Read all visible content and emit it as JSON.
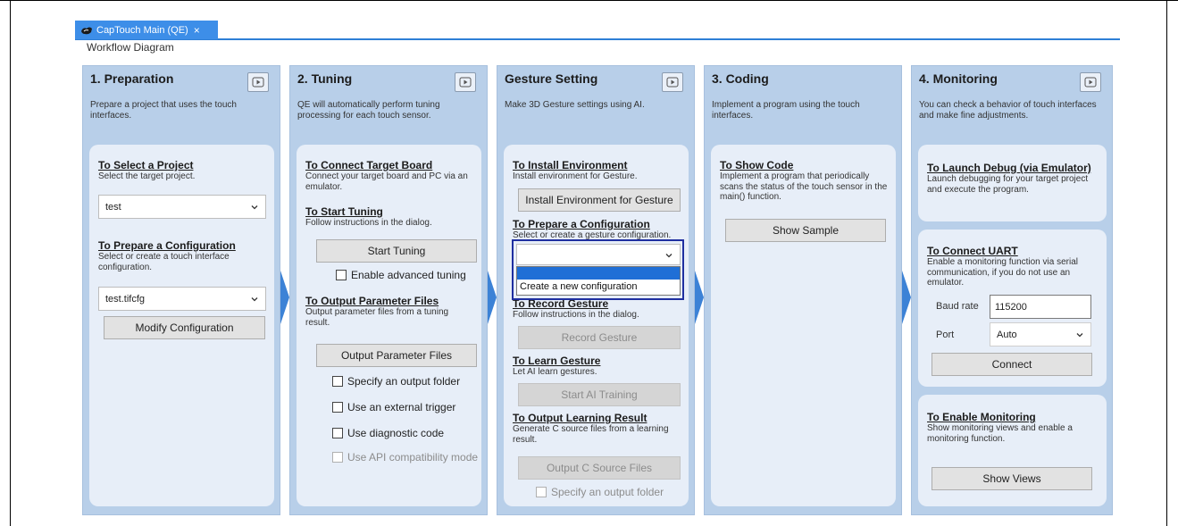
{
  "tab": {
    "title": "CapTouch Main (QE)",
    "close": "×"
  },
  "view_title": "Workflow Diagram",
  "columns": {
    "preparation": {
      "title": "1. Preparation",
      "desc": "Prepare a project that uses the touch interfaces.",
      "select_project": {
        "title": "To Select a Project",
        "desc": "Select the target project.",
        "value": "test"
      },
      "prepare_config": {
        "title": "To Prepare a Configuration",
        "desc": "Select or create a touch interface configuration.",
        "value": "test.tifcfg"
      },
      "modify_button": "Modify Configuration"
    },
    "tuning": {
      "title": "2. Tuning",
      "desc": "QE will automatically perform tuning processing for each touch sensor.",
      "connect": {
        "title": "To Connect Target Board",
        "desc": "Connect your target board and PC via an emulator."
      },
      "start": {
        "title": "To Start Tuning",
        "desc": "Follow instructions in the dialog.",
        "button": "Start Tuning",
        "advanced": "Enable advanced tuning"
      },
      "output": {
        "title": "To Output Parameter Files",
        "desc": "Output parameter files from a tuning result.",
        "button": "Output Parameter Files",
        "opt1": "Specify an output folder",
        "opt2": "Use an external trigger",
        "opt3": "Use diagnostic code",
        "opt4": "Use API compatibility mode"
      }
    },
    "gesture": {
      "title": "Gesture Setting",
      "desc": "Make 3D Gesture settings using AI.",
      "install": {
        "title": "To Install Environment",
        "desc": "Install environment for Gesture.",
        "button": "Install Environment for Gesture"
      },
      "prepare": {
        "title": "To Prepare a Configuration",
        "desc": "Select or create a gesture configuration.",
        "value": "",
        "option_new": "Create a new configuration"
      },
      "record": {
        "title": "To Record Gesture",
        "desc": "Follow instructions in the dialog.",
        "button": "Record Gesture"
      },
      "learn": {
        "title": "To Learn Gesture",
        "desc": "Let AI learn gestures.",
        "button": "Start AI Training"
      },
      "output": {
        "title": "To Output Learning Result",
        "desc": "Generate C source files from a learning result.",
        "button": "Output C Source Files",
        "opt": "Specify an output folder"
      }
    },
    "coding": {
      "title": "3. Coding",
      "desc": "Implement a program using the touch interfaces.",
      "show_code": {
        "title": "To Show Code",
        "desc": "Implement a program that periodically scans the status of the touch sensor in the main() function.",
        "button": "Show Sample"
      }
    },
    "monitoring": {
      "title": "4. Monitoring",
      "desc": "You can check a behavior of touch interfaces and make fine adjustments.",
      "debug": {
        "title": "To Launch Debug (via Emulator)",
        "desc": "Launch debugging for your target project and execute the program."
      },
      "uart": {
        "title": "To Connect UART",
        "desc": "Enable a monitoring function via serial communication, if you do not use an emulator.",
        "baud_label": "Baud rate",
        "baud_value": "115200",
        "port_label": "Port",
        "port_value": "Auto",
        "button": "Connect"
      },
      "enable": {
        "title": "To Enable Monitoring",
        "desc": "Show monitoring views and enable a monitoring function.",
        "button": "Show Views"
      }
    }
  },
  "colors": {
    "column_bg": "#b8cfe9",
    "inner_bg": "#e7eef8",
    "tab_accent": "#3d8ee8",
    "arrow": "#3c82d6",
    "highlight": "#1f2fa0",
    "selected_row": "#1f6fd6"
  },
  "icons": [
    "video-icon",
    "chevron-down-icon",
    "tab-app-icon"
  ]
}
